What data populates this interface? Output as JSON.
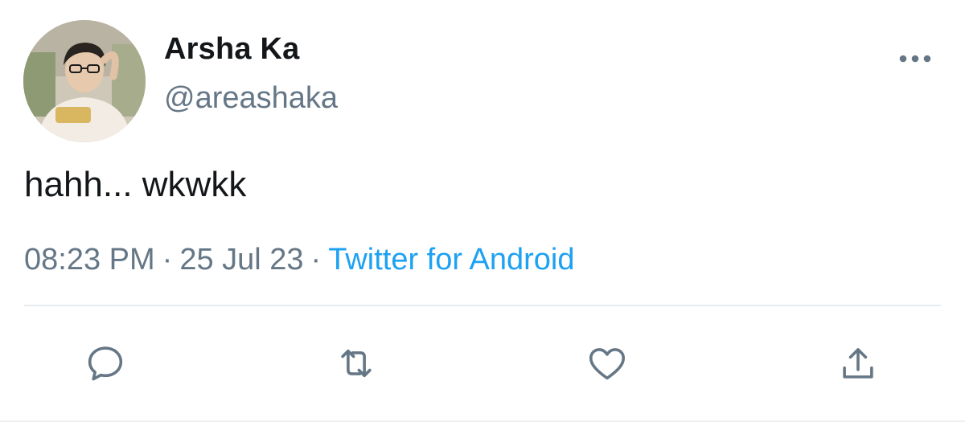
{
  "tweet": {
    "display_name": "Arsha Ka",
    "handle": "@areashaka",
    "text": "hahh... wkwkk",
    "time": "08:23 PM",
    "date": "25 Jul 23",
    "source": "Twitter for Android",
    "separator": "·"
  },
  "icons": {
    "more": "more-horizontal-icon",
    "reply": "reply-icon",
    "retweet": "retweet-icon",
    "like": "heart-icon",
    "share": "share-icon"
  },
  "colors": {
    "text": "#14171a",
    "secondary": "#657786",
    "accent": "#1da1f2",
    "divider": "#e6ecf0"
  }
}
